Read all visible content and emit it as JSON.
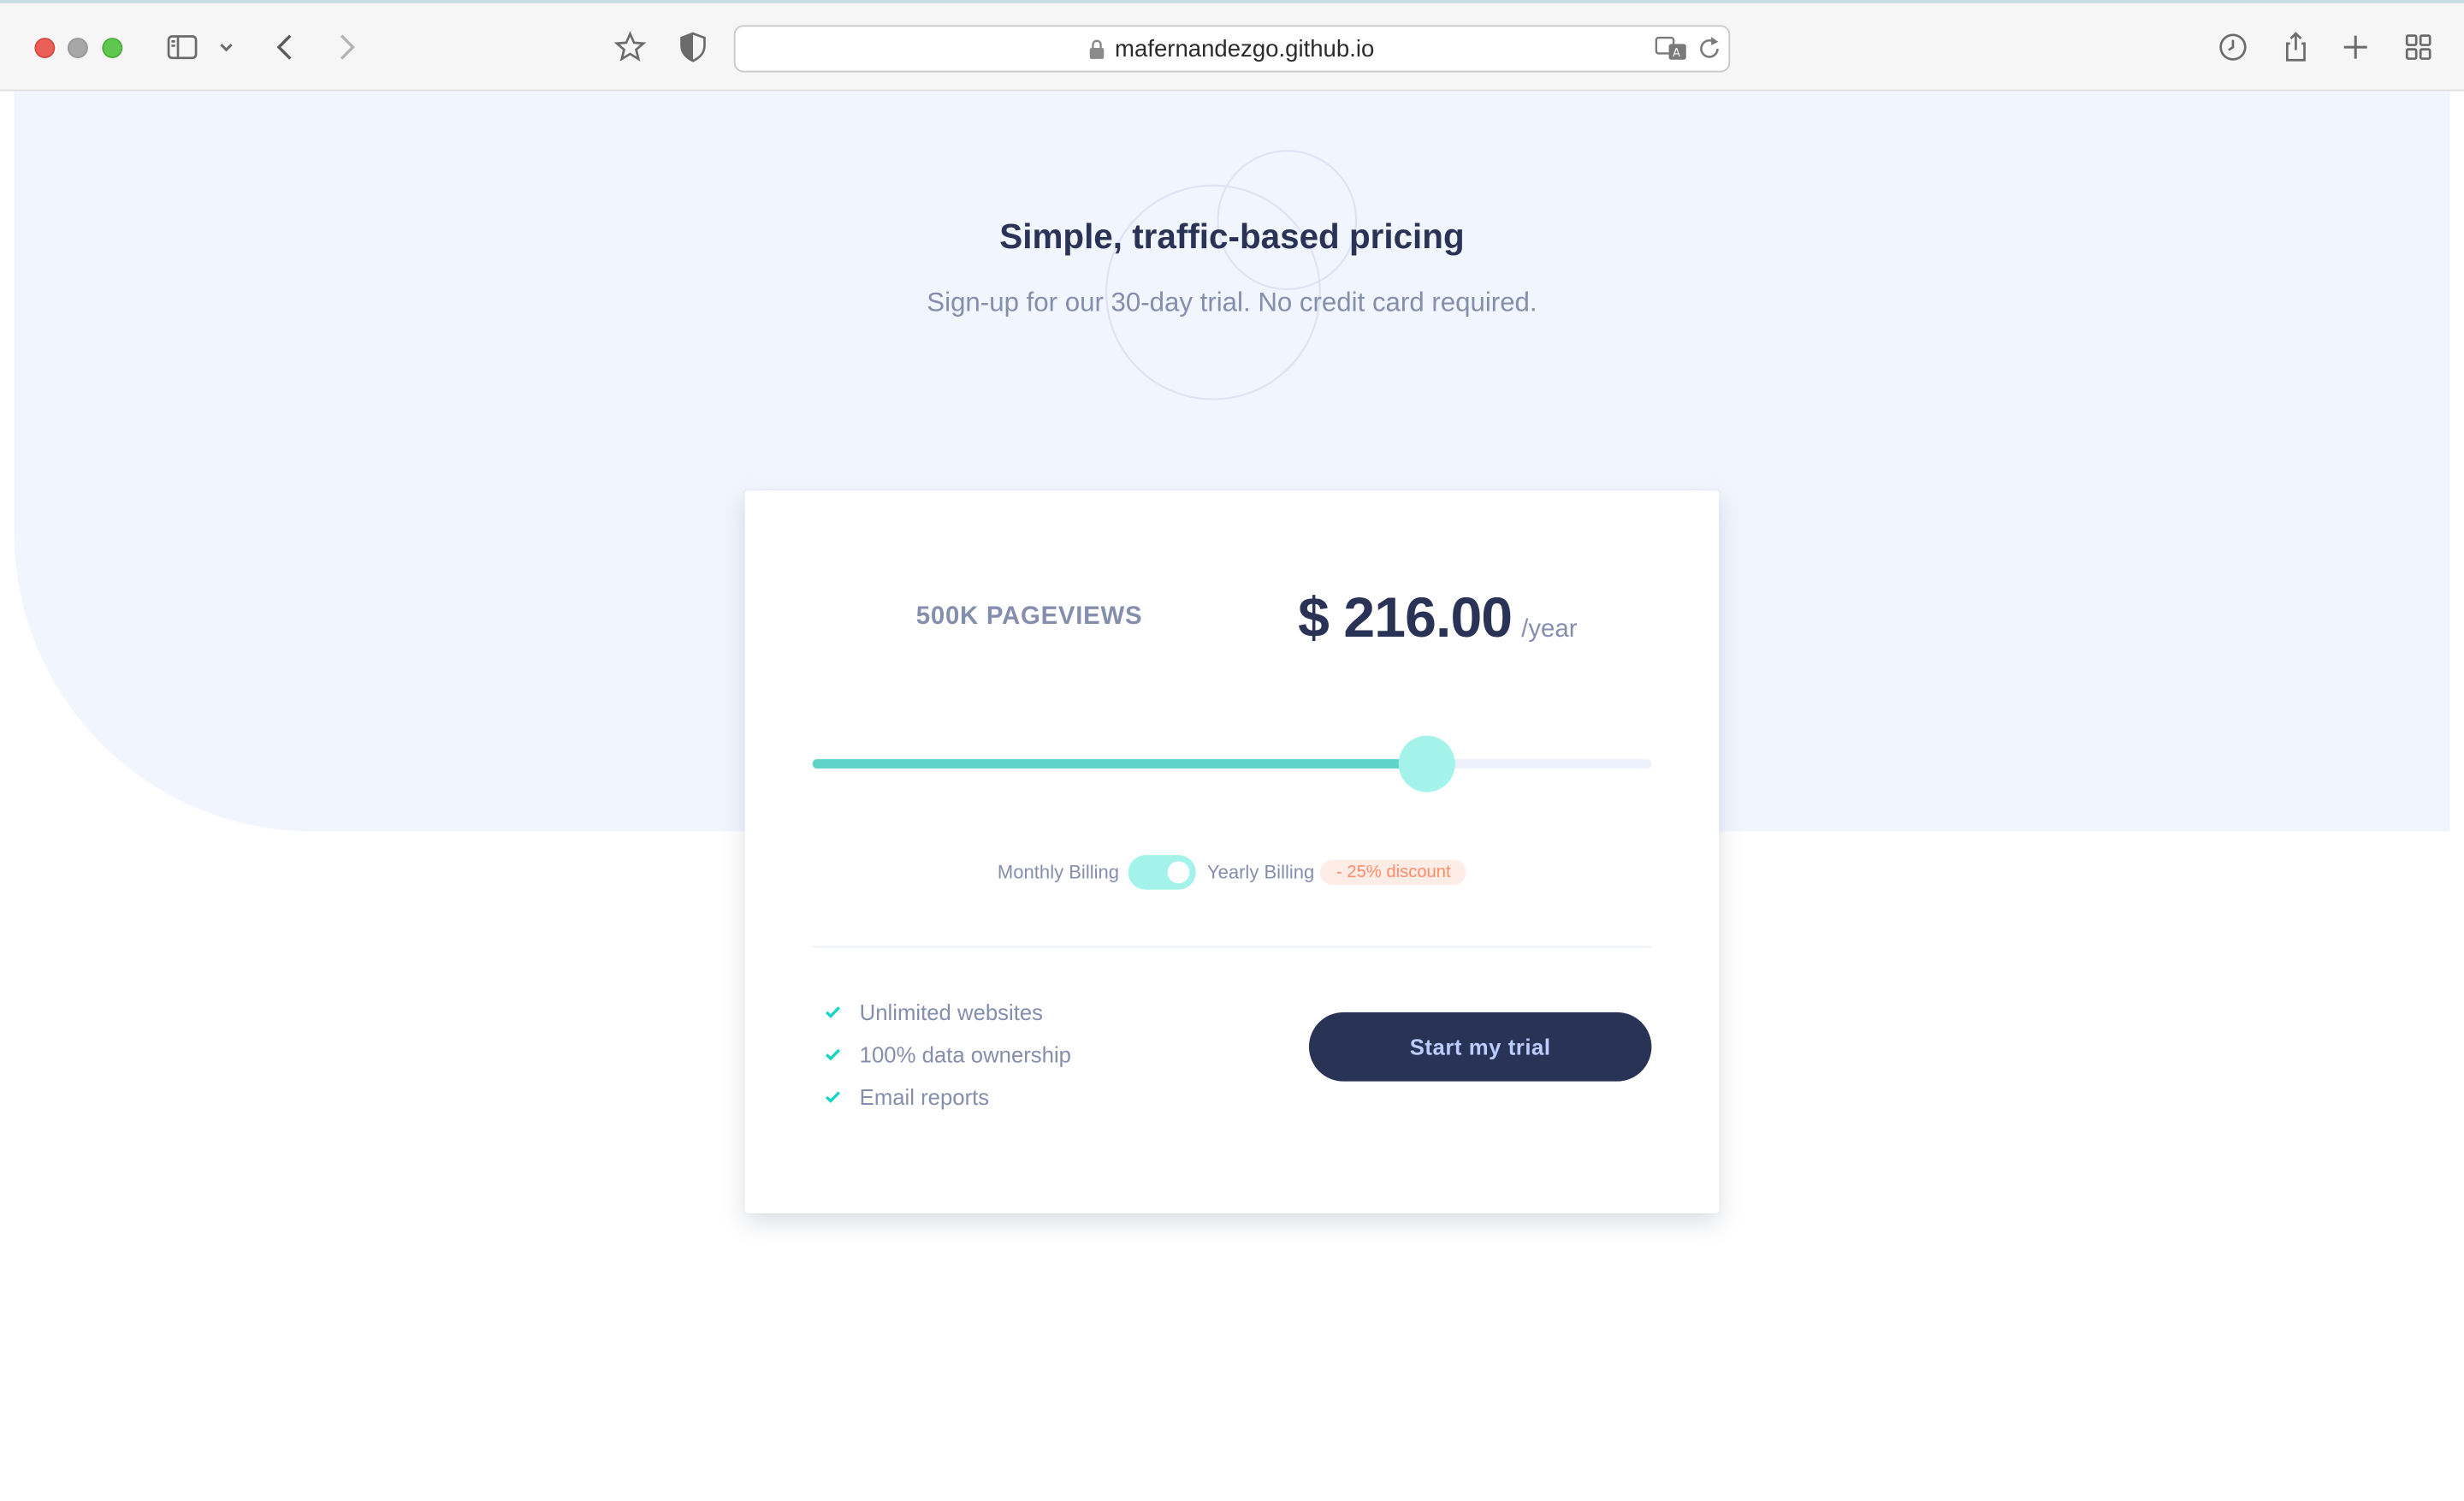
{
  "browser": {
    "url": "mafernandezgo.github.io"
  },
  "hero": {
    "title": "Simple, traffic-based pricing",
    "subtitle": "Sign-up for our 30-day trial. No credit card required."
  },
  "pricing": {
    "pageviews": "500K PAGEVIEWS",
    "price": "$ 216.00",
    "period": "/year",
    "slider_level": 0.733
  },
  "billing": {
    "monthly_label": "Monthly Billing",
    "yearly_label": "Yearly Billing",
    "discount_label": "- 25% discount",
    "yearly_selected": true
  },
  "features": [
    {
      "label": "Unlimited websites"
    },
    {
      "label": "100% data ownership"
    },
    {
      "label": "Email reports"
    }
  ],
  "cta": {
    "label": "Start my trial"
  },
  "colors": {
    "accent": "#10D5C2",
    "dark": "#293356",
    "text_muted": "#848EAD",
    "hero_bg": "#F1F5FE",
    "discount_text": "#FF8C66",
    "discount_bg": "#FEECE7"
  }
}
